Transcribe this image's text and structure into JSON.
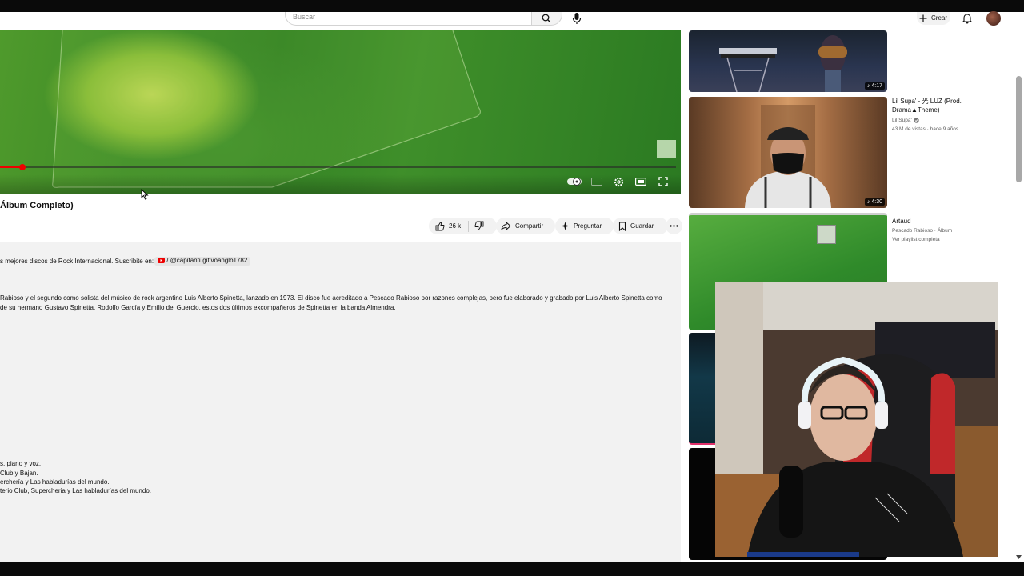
{
  "header": {
    "search_placeholder": "Buscar",
    "create_label": "Crear"
  },
  "video": {
    "title_fragment": "Álbum Completo)",
    "progress_fraction": 0.033
  },
  "actions": {
    "likes": "26 k",
    "share": "Compartir",
    "ask": "Preguntar",
    "save": "Guardar"
  },
  "description": {
    "line1_prefix": "s mejores discos de Rock Internacional. Suscribite en:",
    "channel_link": "/ @capitanfugitivoanglo1782",
    "para1": "Rabioso y el segundo como solista del músico de rock argentino Luis Alberto Spinetta, lanzado en 1973. El disco fue acreditado a Pescado Rabioso por razones complejas, pero fue elaborado y grabado por Luis Alberto Spinetta como",
    "para2": "de su hermano Gustavo Spinetta, Rodolfo García y Emilio del Guercio, estos dos últimos excompañeros de Spinetta en la banda Almendra.",
    "credits": [
      "s, piano y voz.",
      "Club y Bajan.",
      "erchería y Las habladurías del mundo.",
      "terio Club, Supercheria y Las habladurías del mundo."
    ]
  },
  "sidebar": {
    "items": [
      {
        "duration": "4:17"
      },
      {
        "title_line1": "Lil Supa' - 光 LUZ (Prod.",
        "title_line2": "Drama▲Theme)",
        "channel": "Lil Supa'",
        "meta": "43 M de vistas · hace 9 años",
        "duration": "4:30"
      },
      {
        "title": "Artaud",
        "channel": "Pescado Rabioso · Álbum",
        "meta": "Ver playlist completa"
      }
    ]
  },
  "colors": {
    "accent_red": "#e00000",
    "description_bg": "#f2f2f2"
  }
}
